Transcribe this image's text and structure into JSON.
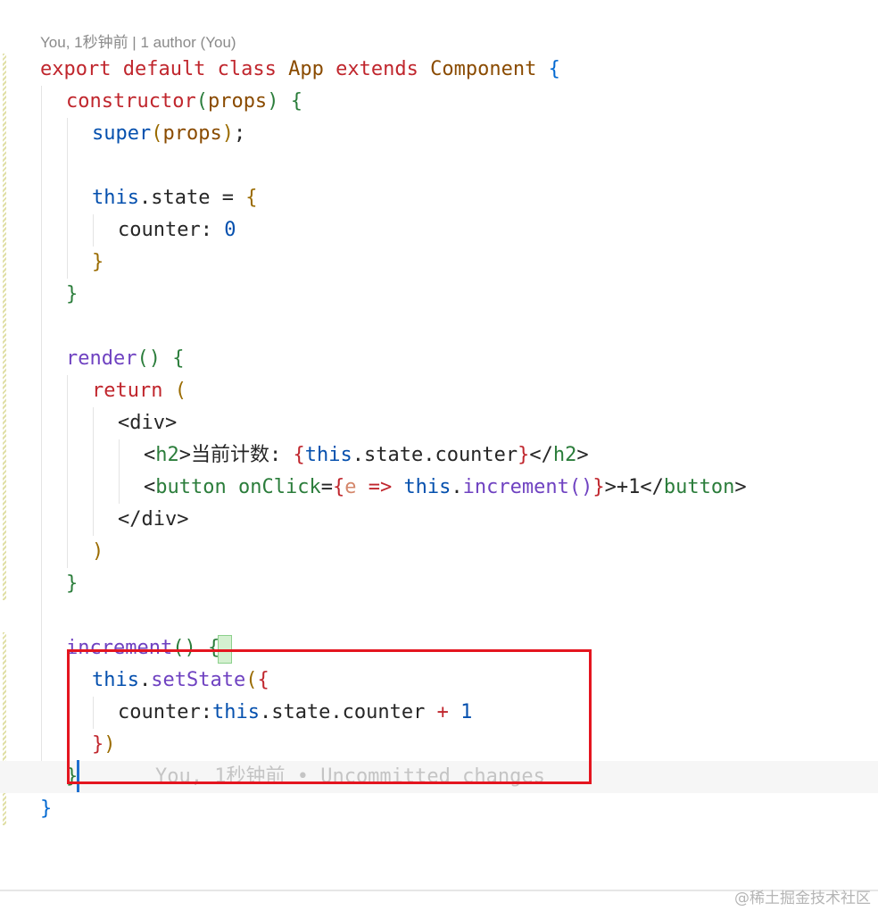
{
  "blame_header": "You, 1秒钟前 | 1 author (You)",
  "code_lines": [
    [
      {
        "t": "export default class ",
        "c": "k"
      },
      {
        "t": "App",
        "c": "cls"
      },
      {
        "t": " extends ",
        "c": "k"
      },
      {
        "t": "Component",
        "c": "cls"
      },
      {
        "t": " ",
        "c": "plain"
      },
      {
        "t": "{",
        "c": "b1"
      }
    ],
    [
      {
        "t": "constructor",
        "c": "k"
      },
      {
        "t": "(",
        "c": "b2"
      },
      {
        "t": "props",
        "c": "pv"
      },
      {
        "t": ")",
        "c": "b2"
      },
      {
        "t": " ",
        "c": "plain"
      },
      {
        "t": "{",
        "c": "b2"
      }
    ],
    [
      {
        "t": "super",
        "c": "kb"
      },
      {
        "t": "(",
        "c": "b3"
      },
      {
        "t": "props",
        "c": "pv"
      },
      {
        "t": ")",
        "c": "b3"
      },
      {
        "t": ";",
        "c": "plain"
      }
    ],
    [],
    [
      {
        "t": "this",
        "c": "kb"
      },
      {
        "t": ".state = ",
        "c": "plain"
      },
      {
        "t": "{",
        "c": "b3"
      }
    ],
    [
      {
        "t": "counter: ",
        "c": "plain"
      },
      {
        "t": "0",
        "c": "num"
      }
    ],
    [
      {
        "t": "}",
        "c": "b3"
      }
    ],
    [
      {
        "t": "}",
        "c": "b2"
      }
    ],
    [],
    [
      {
        "t": "render",
        "c": "fn"
      },
      {
        "t": "()",
        "c": "b2"
      },
      {
        "t": " ",
        "c": "plain"
      },
      {
        "t": "{",
        "c": "b2"
      }
    ],
    [
      {
        "t": "return ",
        "c": "k"
      },
      {
        "t": "(",
        "c": "b3"
      }
    ],
    [
      {
        "t": "<div>",
        "c": "plain"
      }
    ],
    [
      {
        "t": "<",
        "c": "plain"
      },
      {
        "t": "h2",
        "c": "tag"
      },
      {
        "t": ">当前计数: ",
        "c": "plain"
      },
      {
        "t": "{",
        "c": "k"
      },
      {
        "t": "this",
        "c": "kb"
      },
      {
        "t": ".state.counter",
        "c": "plain"
      },
      {
        "t": "}",
        "c": "k"
      },
      {
        "t": "</",
        "c": "plain"
      },
      {
        "t": "h2",
        "c": "tag"
      },
      {
        "t": ">",
        "c": "plain"
      }
    ],
    [
      {
        "t": "<",
        "c": "plain"
      },
      {
        "t": "button",
        "c": "tag"
      },
      {
        "t": " ",
        "c": "plain"
      },
      {
        "t": "onClick",
        "c": "tag"
      },
      {
        "t": "=",
        "c": "plain"
      },
      {
        "t": "{",
        "c": "k"
      },
      {
        "t": "e",
        "c": "param"
      },
      {
        "t": " => ",
        "c": "arrow"
      },
      {
        "t": "this",
        "c": "kb"
      },
      {
        "t": ".",
        "c": "plain"
      },
      {
        "t": "increment",
        "c": "fn"
      },
      {
        "t": "()",
        "c": "fn"
      },
      {
        "t": "}",
        "c": "k"
      },
      {
        "t": ">+1</",
        "c": "plain"
      },
      {
        "t": "button",
        "c": "tag"
      },
      {
        "t": ">",
        "c": "plain"
      }
    ],
    [
      {
        "t": "</div>",
        "c": "plain"
      }
    ],
    [
      {
        "t": ")",
        "c": "b3"
      }
    ],
    [
      {
        "t": "}",
        "c": "b2"
      }
    ],
    [],
    [
      {
        "t": "increment",
        "c": "fn"
      },
      {
        "t": "()",
        "c": "b2"
      },
      {
        "t": " ",
        "c": "plain"
      },
      {
        "t": "{",
        "c": "b2"
      }
    ],
    [
      {
        "t": "this",
        "c": "kb"
      },
      {
        "t": ".",
        "c": "plain"
      },
      {
        "t": "setState",
        "c": "fn"
      },
      {
        "t": "(",
        "c": "b3"
      },
      {
        "t": "{",
        "c": "k"
      }
    ],
    [
      {
        "t": "counter:",
        "c": "plain"
      },
      {
        "t": "this",
        "c": "kb"
      },
      {
        "t": ".state.counter ",
        "c": "plain"
      },
      {
        "t": "+ ",
        "c": "k"
      },
      {
        "t": "1",
        "c": "num"
      }
    ],
    [
      {
        "t": "}",
        "c": "k"
      },
      {
        "t": ")",
        "c": "b3"
      }
    ],
    [
      {
        "t": "}",
        "c": "b2"
      }
    ],
    [
      {
        "t": "}",
        "c": "b1"
      }
    ]
  ],
  "inline_blame": "You, 1秒钟前 • Uncommitted changes",
  "watermark": "@稀土掘金技术社区"
}
